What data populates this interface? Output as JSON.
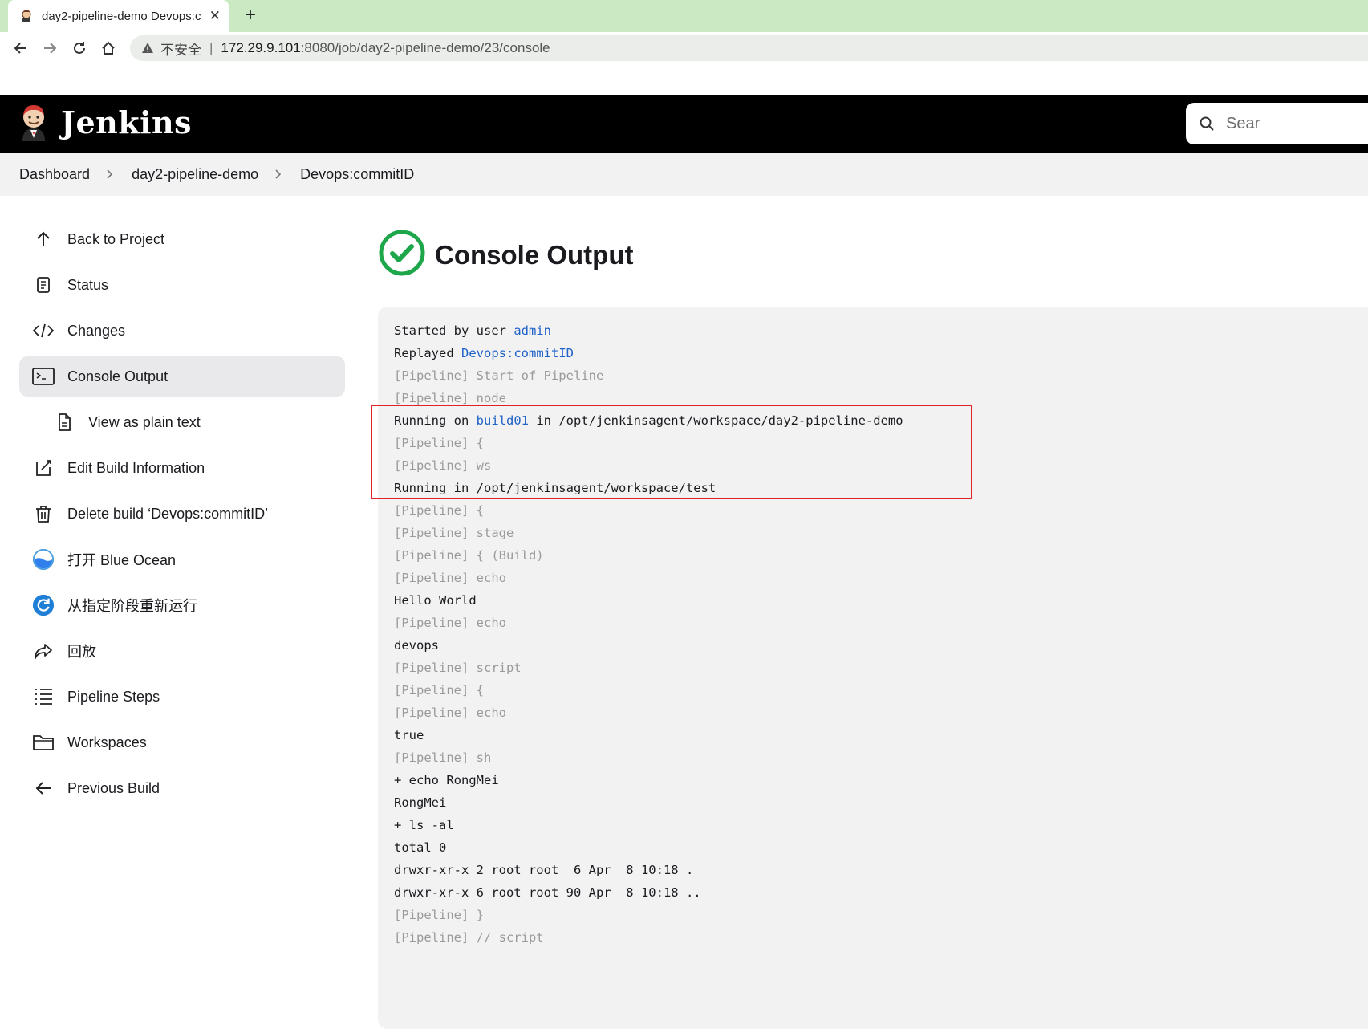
{
  "browser": {
    "tab_title": "day2-pipeline-demo Devops:c",
    "insecure_label": "不安全",
    "separator": "|",
    "url_host": "172.29.9.101",
    "url_path": ":8080/job/day2-pipeline-demo/23/console"
  },
  "header": {
    "app_title": "Jenkins",
    "search_placeholder": "Sear"
  },
  "breadcrumb": [
    "Dashboard",
    "day2-pipeline-demo",
    "Devops:commitID"
  ],
  "sidebar": {
    "items": [
      {
        "label": "Back to Project",
        "icon": "arrow-up-icon"
      },
      {
        "label": "Status",
        "icon": "document-icon"
      },
      {
        "label": "Changes",
        "icon": "code-icon"
      },
      {
        "label": "Console Output",
        "icon": "terminal-icon",
        "active": true
      },
      {
        "label": "View as plain text",
        "icon": "file-icon",
        "sub": true
      },
      {
        "label": "Edit Build Information",
        "icon": "edit-icon"
      },
      {
        "label": "Delete build ‘Devops:commitID’",
        "icon": "trash-icon"
      },
      {
        "label": "打开 Blue Ocean",
        "icon": "blue-ocean-icon"
      },
      {
        "label": "从指定阶段重新运行",
        "icon": "restart-stage-icon"
      },
      {
        "label": "回放",
        "icon": "replay-icon"
      },
      {
        "label": "Pipeline Steps",
        "icon": "list-icon"
      },
      {
        "label": "Workspaces",
        "icon": "folder-icon"
      },
      {
        "label": "Previous Build",
        "icon": "arrow-left-icon"
      }
    ]
  },
  "main": {
    "title": "Console Output",
    "status_color": "#1ea64b",
    "console_lines": [
      {
        "pre": "Started by user ",
        "link": "admin",
        "post": ""
      },
      {
        "pre": "Replayed ",
        "link": "Devops:commitID",
        "post": ""
      },
      {
        "pre": "[Pipeline] Start of Pipeline",
        "pl": true
      },
      {
        "pre": "[Pipeline] node",
        "pl": true
      },
      {
        "pre": "Running on ",
        "link": "build01",
        "post": " in /opt/jenkinsagent/workspace/day2-pipeline-demo"
      },
      {
        "pre": "[Pipeline] {",
        "pl": true
      },
      {
        "pre": "[Pipeline] ws",
        "pl": true
      },
      {
        "pre": "Running in /opt/jenkinsagent/workspace/test"
      },
      {
        "pre": "[Pipeline] {",
        "pl": true
      },
      {
        "pre": "[Pipeline] stage",
        "pl": true
      },
      {
        "pre": "[Pipeline] { (Build)",
        "pl": true
      },
      {
        "pre": "[Pipeline] echo",
        "pl": true
      },
      {
        "pre": "Hello World"
      },
      {
        "pre": "[Pipeline] echo",
        "pl": true
      },
      {
        "pre": "devops"
      },
      {
        "pre": "[Pipeline] script",
        "pl": true
      },
      {
        "pre": "[Pipeline] {",
        "pl": true
      },
      {
        "pre": "[Pipeline] echo",
        "pl": true
      },
      {
        "pre": "true"
      },
      {
        "pre": "[Pipeline] sh",
        "pl": true
      },
      {
        "pre": "+ echo RongMei"
      },
      {
        "pre": "RongMei"
      },
      {
        "pre": "+ ls -al"
      },
      {
        "pre": "total 0"
      },
      {
        "pre": "drwxr-xr-x 2 root root  6 Apr  8 10:18 ."
      },
      {
        "pre": "drwxr-xr-x 6 root root 90 Apr  8 10:18 .."
      },
      {
        "pre": "[Pipeline] }",
        "pl": true
      },
      {
        "pre": "[Pipeline] // script",
        "pl": true
      }
    ]
  }
}
